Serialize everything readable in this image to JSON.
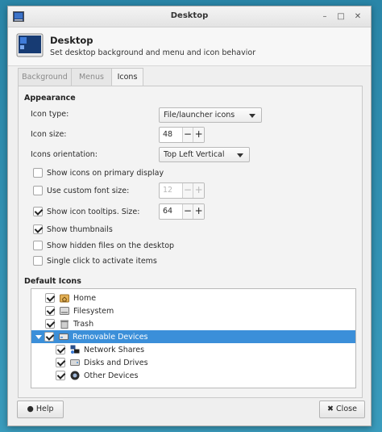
{
  "window": {
    "title": "Desktop"
  },
  "header": {
    "title": "Desktop",
    "subtitle": "Set desktop background and menu and icon behavior"
  },
  "tabs": [
    {
      "label": "Background",
      "active": false
    },
    {
      "label": "Menus",
      "active": false
    },
    {
      "label": "Icons",
      "active": true
    }
  ],
  "appearance": {
    "title": "Appearance",
    "icon_type_label": "Icon type:",
    "icon_type_value": "File/launcher icons",
    "icon_size_label": "Icon size:",
    "icon_size_value": "48",
    "icons_orientation_label": "Icons orientation:",
    "icons_orientation_value": "Top Left Vertical",
    "show_primary_label": "Show icons on primary display",
    "show_primary_checked": false,
    "custom_font_label": "Use custom font size:",
    "custom_font_checked": false,
    "custom_font_value": "12",
    "tooltips_label": "Show icon tooltips. Size:",
    "tooltips_checked": true,
    "tooltips_value": "64",
    "thumbnails_label": "Show thumbnails",
    "thumbnails_checked": true,
    "hidden_files_label": "Show hidden files on the desktop",
    "hidden_files_checked": false,
    "single_click_label": "Single click to activate items",
    "single_click_checked": false
  },
  "default_icons": {
    "title": "Default Icons",
    "items": [
      {
        "label": "Home",
        "checked": true,
        "icon": "home-folder-icon"
      },
      {
        "label": "Filesystem",
        "checked": true,
        "icon": "filesystem-icon"
      },
      {
        "label": "Trash",
        "checked": true,
        "icon": "trash-icon"
      },
      {
        "label": "Removable Devices",
        "checked": true,
        "icon": "removable-devices-icon",
        "selected": true,
        "expanded": true
      },
      {
        "label": "Network Shares",
        "checked": true,
        "icon": "network-shares-icon",
        "child": true
      },
      {
        "label": "Disks and Drives",
        "checked": true,
        "icon": "disks-drives-icon",
        "child": true
      },
      {
        "label": "Other Devices",
        "checked": true,
        "icon": "other-devices-icon",
        "child": true
      }
    ]
  },
  "buttons": {
    "help_label": "Help",
    "close_label": "Close"
  },
  "spin_symbols": {
    "minus": "−",
    "plus": "+"
  },
  "colors": {
    "selection": "#3b8fd9",
    "desktop_bg": "#2a86a8"
  }
}
